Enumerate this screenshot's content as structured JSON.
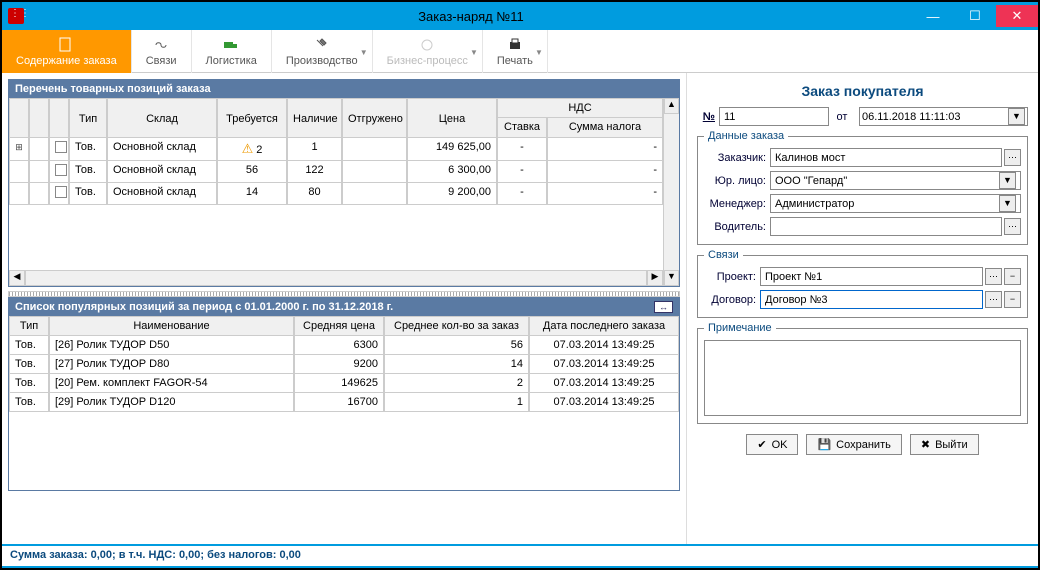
{
  "window": {
    "title": "Заказ-наряд №11"
  },
  "ribbon": {
    "items": [
      {
        "label": "Содержание заказа"
      },
      {
        "label": "Связи"
      },
      {
        "label": "Логистика"
      },
      {
        "label": "Производство"
      },
      {
        "label": "Бизнес-процесс"
      },
      {
        "label": "Печать"
      }
    ]
  },
  "positions": {
    "title": "Перечень товарных позиций заказа",
    "headers": {
      "type": "Тип",
      "sklad": "Склад",
      "treb": "Требуется",
      "nal": "Наличие",
      "otgr": "Отгружено",
      "cena": "Цена",
      "nds": "НДС",
      "stavka": "Ставка",
      "summa": "Сумма налога"
    },
    "rows": [
      {
        "type": "Тов.",
        "sklad": "Основной склад",
        "treb": "2",
        "nal": "1",
        "otgr": "",
        "cena": "149 625,00",
        "stavka": "-",
        "summa": "-",
        "warn": true,
        "expand": true
      },
      {
        "type": "Тов.",
        "sklad": "Основной склад",
        "treb": "56",
        "nal": "122",
        "otgr": "",
        "cena": "6 300,00",
        "stavka": "-",
        "summa": "-",
        "warn": false,
        "expand": false
      },
      {
        "type": "Тов.",
        "sklad": "Основной склад",
        "treb": "14",
        "nal": "80",
        "otgr": "",
        "cena": "9 200,00",
        "stavka": "-",
        "summa": "-",
        "warn": false,
        "expand": false
      }
    ]
  },
  "popular": {
    "title": "Список популярных позиций за период с 01.01.2000 г. по 31.12.2018 г.",
    "headers": {
      "type": "Тип",
      "name": "Наименование",
      "avgp": "Средняя цена",
      "avgq": "Среднее кол-во   за заказ",
      "last": "Дата последнего заказа"
    },
    "rows": [
      {
        "type": "Тов.",
        "name": "[26] Ролик ТУДОР D50",
        "avgp": "6300",
        "avgq": "56",
        "last": "07.03.2014 13:49:25"
      },
      {
        "type": "Тов.",
        "name": "[27] Ролик ТУДОР D80",
        "avgp": "9200",
        "avgq": "14",
        "last": "07.03.2014 13:49:25"
      },
      {
        "type": "Тов.",
        "name": "[20] Рем. комплект FAGOR-54",
        "avgp": "149625",
        "avgq": "2",
        "last": "07.03.2014 13:49:25"
      },
      {
        "type": "Тов.",
        "name": "[29] Ролик ТУДОР D120",
        "avgp": "16700",
        "avgq": "1",
        "last": "07.03.2014 13:49:25"
      }
    ]
  },
  "right": {
    "title": "Заказ покупателя",
    "num_label": "№",
    "num": "11",
    "ot_label": "от",
    "ot": "06.11.2018 11:11:03",
    "gb_order": "Данные заказа",
    "zakazchik_l": "Заказчик:",
    "zakazchik": "Калинов мост",
    "yur_l": "Юр. лицо:",
    "yur": "ООО \"Гепард\"",
    "manager_l": "Менеджер:",
    "manager": "Администратор",
    "vodit_l": "Водитель:",
    "vodit": "",
    "gb_links": "Связи",
    "proekt_l": "Проект:",
    "proekt": "Проект №1",
    "dogovor_l": "Договор:",
    "dogovor": "Договор №3",
    "gb_notes": "Примечание",
    "btn_ok": "OK",
    "btn_save": "Сохранить",
    "btn_exit": "Выйти"
  },
  "status": "Сумма заказа: 0,00; в т.ч. НДС: 0,00; без налогов: 0,00"
}
